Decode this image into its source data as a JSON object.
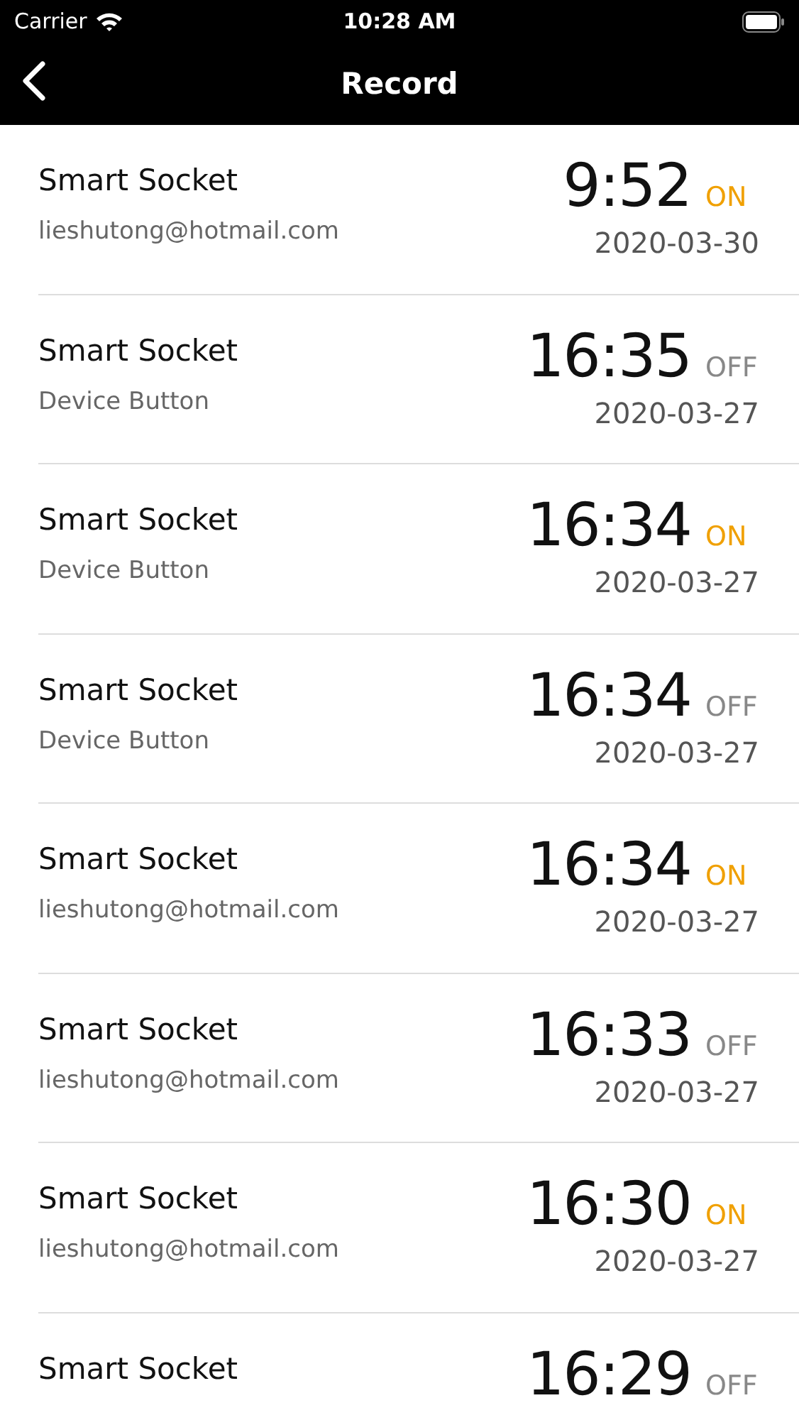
{
  "status_bar": {
    "carrier": "Carrier",
    "time": "10:28 AM"
  },
  "nav": {
    "title": "Record"
  },
  "records": [
    {
      "device": "Smart Socket",
      "source": "lieshutong@hotmail.com",
      "time": "9:52",
      "state": "ON",
      "on": true,
      "date": "2020-03-30"
    },
    {
      "device": "Smart Socket",
      "source": "Device Button",
      "time": "16:35",
      "state": "OFF",
      "on": false,
      "date": "2020-03-27"
    },
    {
      "device": "Smart Socket",
      "source": "Device Button",
      "time": "16:34",
      "state": "ON",
      "on": true,
      "date": "2020-03-27"
    },
    {
      "device": "Smart Socket",
      "source": "Device Button",
      "time": "16:34",
      "state": "OFF",
      "on": false,
      "date": "2020-03-27"
    },
    {
      "device": "Smart Socket",
      "source": "lieshutong@hotmail.com",
      "time": "16:34",
      "state": "ON",
      "on": true,
      "date": "2020-03-27"
    },
    {
      "device": "Smart Socket",
      "source": "lieshutong@hotmail.com",
      "time": "16:33",
      "state": "OFF",
      "on": false,
      "date": "2020-03-27"
    },
    {
      "device": "Smart Socket",
      "source": "lieshutong@hotmail.com",
      "time": "16:30",
      "state": "ON",
      "on": true,
      "date": "2020-03-27"
    },
    {
      "device": "Smart Socket",
      "time": "16:29",
      "state": "OFF",
      "on": false
    }
  ]
}
